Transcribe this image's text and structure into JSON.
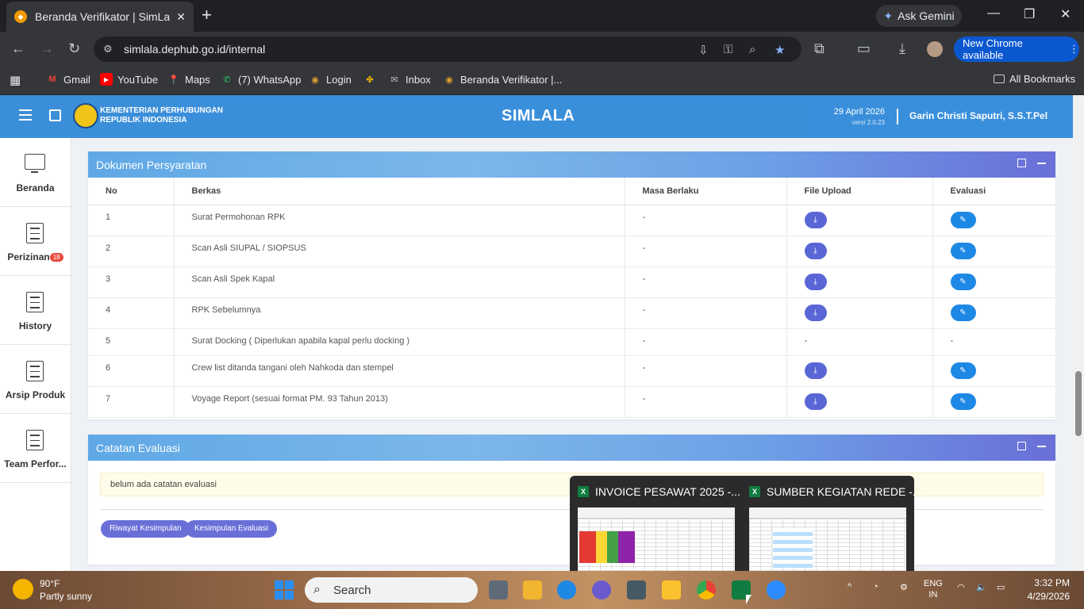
{
  "browser": {
    "tab_title": "Beranda Verifikator | SimLala",
    "gemini_label": "Ask Gemini",
    "url": "simlala.dephub.go.id/internal",
    "new_chrome_label": "New Chrome available",
    "bookmarks": [
      "Gmail",
      "YouTube",
      "Maps",
      "(7) WhatsApp",
      "Login",
      "Inbox",
      "Beranda Verifikator |..."
    ],
    "all_bookmarks_label": "All Bookmarks"
  },
  "header": {
    "org_line1": "KEMENTERIAN PERHUBUNGAN",
    "org_line2": "REPUBLIK INDONESIA",
    "app_name": "SIMLALA",
    "date": "29 April 2026",
    "version": "versi 2.0.23",
    "user_name": "Garin Christi Saputri, S.S.T.Pel"
  },
  "sidebar": {
    "items": [
      {
        "label": "Beranda",
        "icon": "monitor-icon"
      },
      {
        "label": "Perizinan",
        "icon": "document-icon",
        "badge": "18"
      },
      {
        "label": "History",
        "icon": "document-icon"
      },
      {
        "label": "Arsip Produk",
        "icon": "document-icon"
      },
      {
        "label": "Team Perfor...",
        "icon": "document-icon"
      }
    ]
  },
  "documents": {
    "title": "Dokumen Persyaratan",
    "columns": [
      "No",
      "Berkas",
      "Masa Berlaku",
      "File Upload",
      "Evaluasi"
    ],
    "rows": [
      {
        "no": "1",
        "berkas": "Surat Permohonan RPK",
        "masa": "-",
        "upload": "download",
        "eval": "edit"
      },
      {
        "no": "2",
        "berkas": "Scan Asli SIUPAL / SIOPSUS",
        "masa": "-",
        "upload": "download",
        "eval": "edit"
      },
      {
        "no": "3",
        "berkas": "Scan Asli Spek Kapal",
        "masa": "-",
        "upload": "download",
        "eval": "edit"
      },
      {
        "no": "4",
        "berkas": "RPK Sebelumnya",
        "masa": "-",
        "upload": "download",
        "eval": "edit"
      },
      {
        "no": "5",
        "berkas": "Surat Docking ( Diperlukan apabila kapal perlu docking )",
        "masa": "-",
        "upload": "-",
        "eval": "-"
      },
      {
        "no": "6",
        "berkas": "Crew list ditanda tangani oleh Nahkoda dan stempel",
        "masa": "-",
        "upload": "download",
        "eval": "edit"
      },
      {
        "no": "7",
        "berkas": "Voyage Report (sesuai format PM. 93 Tahun 2013)",
        "masa": "-",
        "upload": "download",
        "eval": "edit"
      }
    ]
  },
  "evaluation": {
    "title": "Catatan Evaluasi",
    "note": "belum ada catatan evaluasi",
    "btn_history": "Riwayat Kesimpulan",
    "btn_conclusion": "Kesimpulan Evaluasi"
  },
  "thumbnails": [
    {
      "title": "INVOICE PESAWAT 2025 -..."
    },
    {
      "title": "SUMBER KEGIATAN REDE -..."
    }
  ],
  "taskbar": {
    "temp": "90°F",
    "weather": "Partly sunny",
    "search_placeholder": "Search",
    "lang1": "ENG",
    "lang2": "IN",
    "time": "3:32 PM",
    "date": "4/29/2026"
  },
  "colors": {
    "app_header": "#3b8fd9",
    "accent_button": "#5a66d6",
    "eval_button": "#1e88e5",
    "badge": "#e74c3c"
  }
}
